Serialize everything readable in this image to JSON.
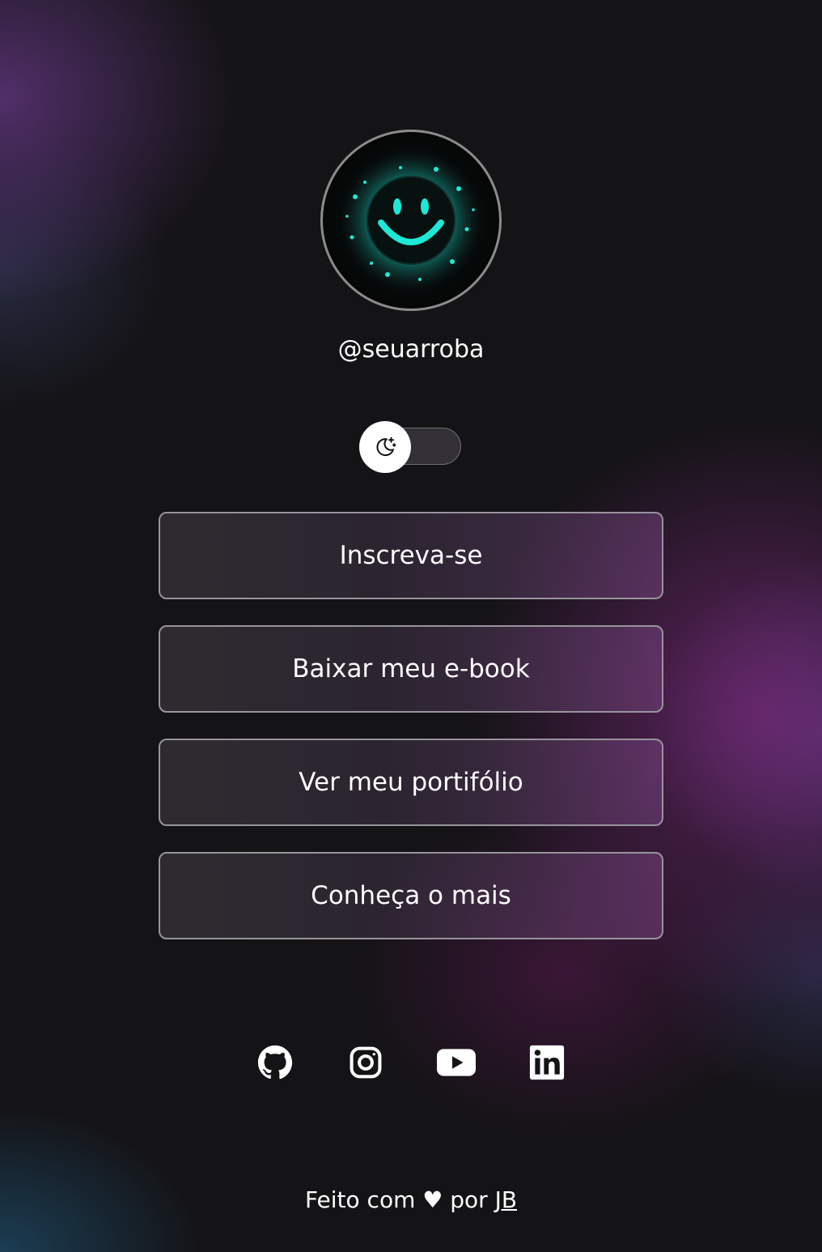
{
  "profile": {
    "handle": "@seuarroba",
    "avatar_icon": "smiley-icon",
    "avatar_color": "#1de9d6"
  },
  "theme_toggle": {
    "icon": "moon-stars-icon",
    "state": "dark"
  },
  "links": [
    {
      "label": "Inscreva-se"
    },
    {
      "label": "Baixar meu e-book"
    },
    {
      "label": "Ver meu portifólio"
    },
    {
      "label": "Conheça o mais"
    }
  ],
  "socials": [
    {
      "icon": "github-icon"
    },
    {
      "icon": "instagram-icon"
    },
    {
      "icon": "youtube-icon"
    },
    {
      "icon": "linkedin-icon"
    }
  ],
  "footer": {
    "prefix": "Feito com ♥ por",
    "author": "JB"
  }
}
